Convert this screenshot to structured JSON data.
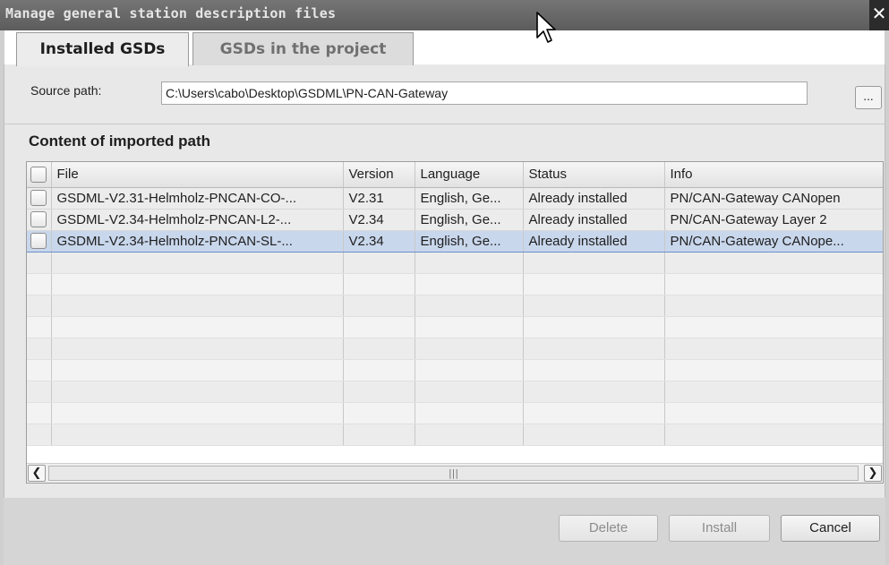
{
  "window": {
    "title": "Manage general station description files",
    "close_glyph": "✕"
  },
  "tabs": [
    {
      "label": "Installed GSDs",
      "active": true
    },
    {
      "label": "GSDs in the project",
      "active": false
    }
  ],
  "source": {
    "label": "Source path:",
    "value": "C:\\Users\\cabo\\Desktop\\GSDML\\PN-CAN-Gateway",
    "browse_label": "..."
  },
  "content": {
    "title": "Content of imported path",
    "columns": [
      "File",
      "Version",
      "Language",
      "Status",
      "Info"
    ],
    "rows": [
      {
        "file": "GSDML-V2.31-Helmholz-PNCAN-CO-...",
        "version": "V2.31",
        "language": "English, Ge...",
        "status": "Already installed",
        "info": "PN/CAN-Gateway CANopen",
        "checked": false,
        "selected": false
      },
      {
        "file": "GSDML-V2.34-Helmholz-PNCAN-L2-...",
        "version": "V2.34",
        "language": "English, Ge...",
        "status": "Already installed",
        "info": "PN/CAN-Gateway Layer 2",
        "checked": false,
        "selected": false
      },
      {
        "file": "GSDML-V2.34-Helmholz-PNCAN-SL-...",
        "version": "V2.34",
        "language": "English, Ge...",
        "status": "Already installed",
        "info": "PN/CAN-Gateway CANope...",
        "checked": false,
        "selected": true
      }
    ],
    "scroll_thumb_glyph": "|||"
  },
  "buttons": {
    "delete": "Delete",
    "install": "Install",
    "cancel": "Cancel"
  },
  "colors": {
    "selection": "#c9d7ec",
    "titlebar": "#6a6a6a"
  }
}
